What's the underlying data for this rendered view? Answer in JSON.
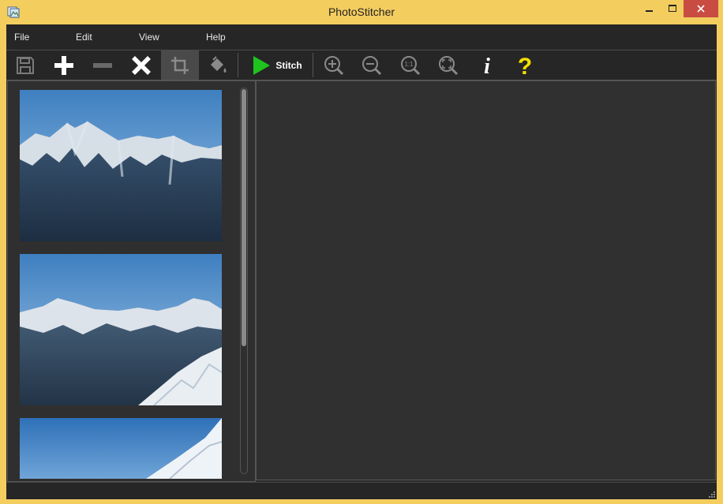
{
  "window": {
    "title": "PhotoStitcher"
  },
  "menu": {
    "items": [
      "File",
      "Edit",
      "View",
      "Help"
    ]
  },
  "toolbar": {
    "stitch_label": "Stitch"
  },
  "colors": {
    "frame": "#f4cd5f",
    "background": "#2b2b2b",
    "accent_play": "#1ec41e",
    "help_yellow": "#f5e000",
    "close_red": "#c94c43"
  },
  "icons": [
    "save-icon",
    "plus-icon",
    "minus-icon",
    "x-icon",
    "crop-icon",
    "paint-bucket-icon",
    "play-icon",
    "zoom-in-icon",
    "zoom-out-icon",
    "actual-size-icon",
    "fit-window-icon",
    "info-icon",
    "help-icon"
  ],
  "zoom": {
    "actual_size_label": "1:1"
  },
  "info_glyph": "i",
  "help_glyph": "?"
}
